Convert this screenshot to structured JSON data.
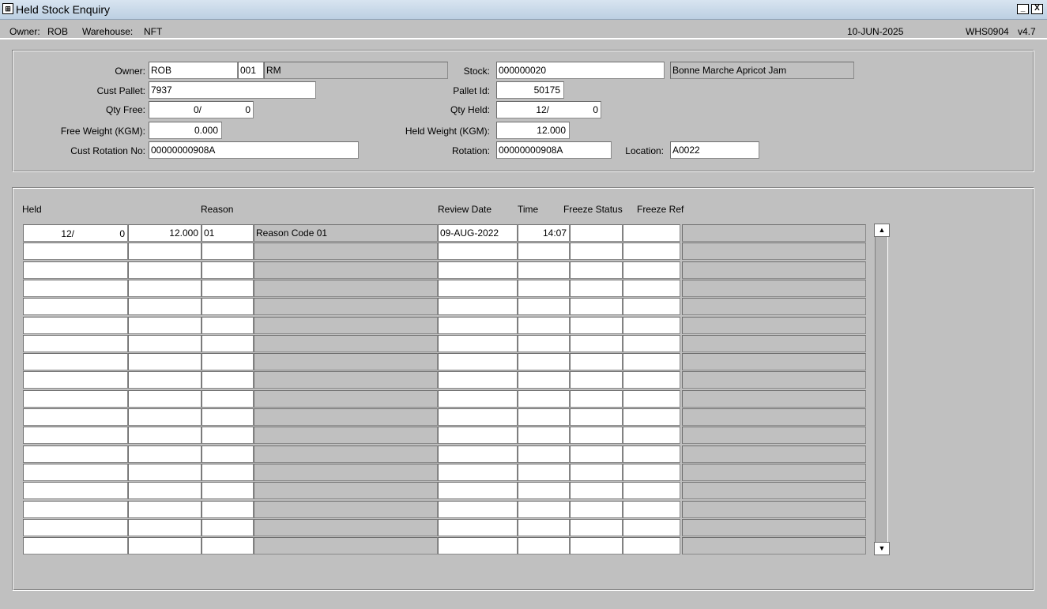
{
  "window": {
    "title": "Held Stock Enquiry",
    "app_icon": "app-icon",
    "minimize_glyph": "_",
    "close_glyph": "X"
  },
  "infobar": {
    "owner_label": "Owner:",
    "owner_value": "ROB",
    "warehouse_label": "Warehouse:",
    "warehouse_value": "NFT",
    "date": "10-JUN-2025",
    "program": "WHS0904",
    "version": "v4.7"
  },
  "header_form": {
    "owner": {
      "label": "Owner:",
      "code": "ROB",
      "sub": "001",
      "name": "RM"
    },
    "cust_pallet": {
      "label": "Cust Pallet:",
      "value": "7937"
    },
    "qty_free": {
      "label": "Qty Free:",
      "cases": "0/",
      "units": "0"
    },
    "free_weight": {
      "label": "Free Weight (KGM):",
      "value": "0.000"
    },
    "cust_rotation": {
      "label": "Cust Rotation No:",
      "value": "00000000908A"
    },
    "stock": {
      "label": "Stock:",
      "code": "000000020",
      "description": "Bonne Marche Apricot Jam"
    },
    "pallet_id": {
      "label": "Pallet Id:",
      "value": "50175"
    },
    "qty_held": {
      "label": "Qty Held:",
      "cases": "12/",
      "units": "0"
    },
    "held_weight": {
      "label": "Held Weight (KGM):",
      "value": "12.000"
    },
    "rotation": {
      "label": "Rotation:",
      "value": "00000000908A"
    },
    "location": {
      "label": "Location:",
      "value": "A0022"
    }
  },
  "grid": {
    "headers": {
      "held": "Held",
      "reason": "Reason",
      "review_date": "Review Date",
      "time": "Time",
      "freeze_status": "Freeze Status",
      "freeze_ref": "Freeze Ref"
    },
    "rows": [
      {
        "held_cases": "12/",
        "held_units": "0",
        "weight": "12.000",
        "reason_code": "01",
        "reason_desc": "Reason Code 01",
        "review_date": "09-AUG-2022",
        "time": "14:07",
        "freeze_status": "",
        "freeze_ref": "",
        "extra": ""
      }
    ],
    "blank_row_count": 17,
    "scroll_up_icon": "arrow-up-icon",
    "scroll_down_icon": "arrow-down-icon"
  }
}
